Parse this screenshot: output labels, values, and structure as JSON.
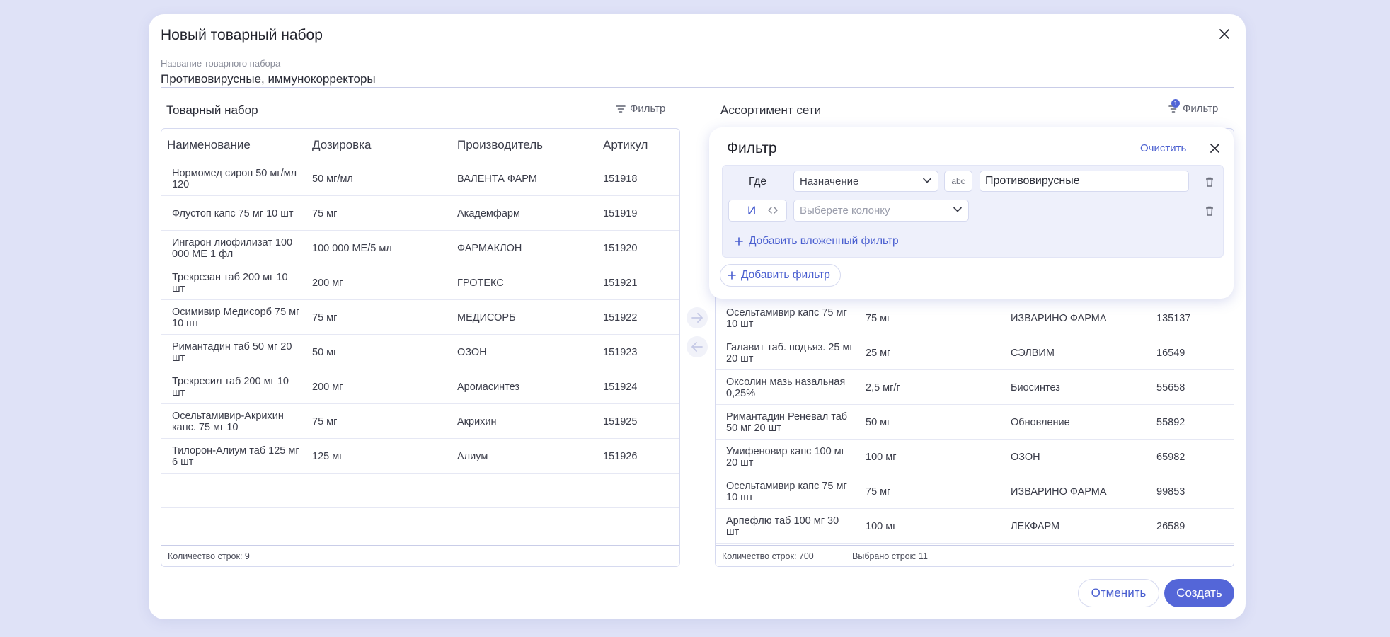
{
  "dialog": {
    "title": "Новый товарный набор",
    "name_label": "Название товарного набора",
    "name_value": "Противовирусные, иммунокорректоры"
  },
  "left_panel": {
    "title": "Товарный набор",
    "filter_label": "Фильтр",
    "columns": [
      "Наименование",
      "Дозировка",
      "Производитель",
      "Артикул"
    ],
    "rows": [
      {
        "name": "Нормомед сироп 50 мг/мл 120",
        "dose": "50 мг/мл",
        "maker": "ВАЛЕНТА ФАРМ",
        "sku": "151918"
      },
      {
        "name": "Флустоп капс 75 мг 10 шт",
        "dose": "75 мг",
        "maker": "Академфарм",
        "sku": "151919"
      },
      {
        "name": "Ингарон лиофилизат 100 000 МЕ 1 фл",
        "dose": "100 000 МЕ/5 мл",
        "maker": "ФАРМАКЛОН",
        "sku": "151920"
      },
      {
        "name": "Трекрезан таб 200 мг 10 шт",
        "dose": "200 мг",
        "maker": "ГРОТЕКС",
        "sku": "151921"
      },
      {
        "name": "Осимивир Медисорб 75 мг 10 шт",
        "dose": "75 мг",
        "maker": "МЕДИСОРБ",
        "sku": "151922"
      },
      {
        "name": "Римантадин таб 50 мг 20 шт",
        "dose": "50 мг",
        "maker": "ОЗОН",
        "sku": "151923"
      },
      {
        "name": "Трекресил таб 200 мг 10 шт",
        "dose": "200 мг",
        "maker": "Аромасинтез",
        "sku": "151924"
      },
      {
        "name": "Осельтамивир-Акрихин капс. 75 мг 10",
        "dose": "75 мг",
        "maker": "Акрихин",
        "sku": "151925"
      },
      {
        "name": "Тилорон-Алиум таб 125 мг 6 шт",
        "dose": "125 мг",
        "maker": "Алиум",
        "sku": "151926"
      }
    ],
    "row_count": "Количество строк: 9"
  },
  "right_panel": {
    "title": "Ассортимент сети",
    "filter_label": "Фильтр",
    "filter_badge": "1",
    "rows": [
      {
        "name": "Осельтамивир капс 75 мг 10 шт",
        "dose": "75 мг",
        "maker": "ИЗВАРИНО ФАРМА",
        "sku": "135137"
      },
      {
        "name": "Галавит таб. подъяз. 25 мг 20 шт",
        "dose": "25 мг",
        "maker": "СЭЛВИМ",
        "sku": "16549"
      },
      {
        "name": "Оксолин мазь назальная 0,25%",
        "dose": "2,5 мг/г",
        "maker": "Биосинтез",
        "sku": "55658"
      },
      {
        "name": "Римантадин Реневал таб 50 мг 20 шт",
        "dose": "50 мг",
        "maker": "Обновление",
        "sku": "55892"
      },
      {
        "name": "Умифеновир капс 100 мг 20 шт",
        "dose": "100 мг",
        "maker": "ОЗОН",
        "sku": "65982"
      },
      {
        "name": "Осельтамивир капс 75 мг 10 шт",
        "dose": "75 мг",
        "maker": "ИЗВАРИНО ФАРМА",
        "sku": "99853"
      },
      {
        "name": "Арпефлю таб 100 мг 30 шт",
        "dose": "100 мг",
        "maker": "ЛЕКФАРМ",
        "sku": "26589"
      }
    ],
    "row_count": "Количество строк: 700",
    "selected_count": "Выбрано строк: 11"
  },
  "filter_popup": {
    "title": "Фильтр",
    "clear_label": "Очистить",
    "where_label": "Где",
    "column_select": "Назначение",
    "type_badge": "abc",
    "value": "Противовирусные",
    "and_label": "И",
    "column_placeholder": "Выберете колонку",
    "add_nested_label": "Добавить вложенный фильтр",
    "add_filter_label": "Добавить фильтр"
  },
  "actions": {
    "cancel_label": "Отменить",
    "create_label": "Создать"
  },
  "colors": {
    "accent": "#5466d8",
    "background": "#dfe2f7"
  }
}
